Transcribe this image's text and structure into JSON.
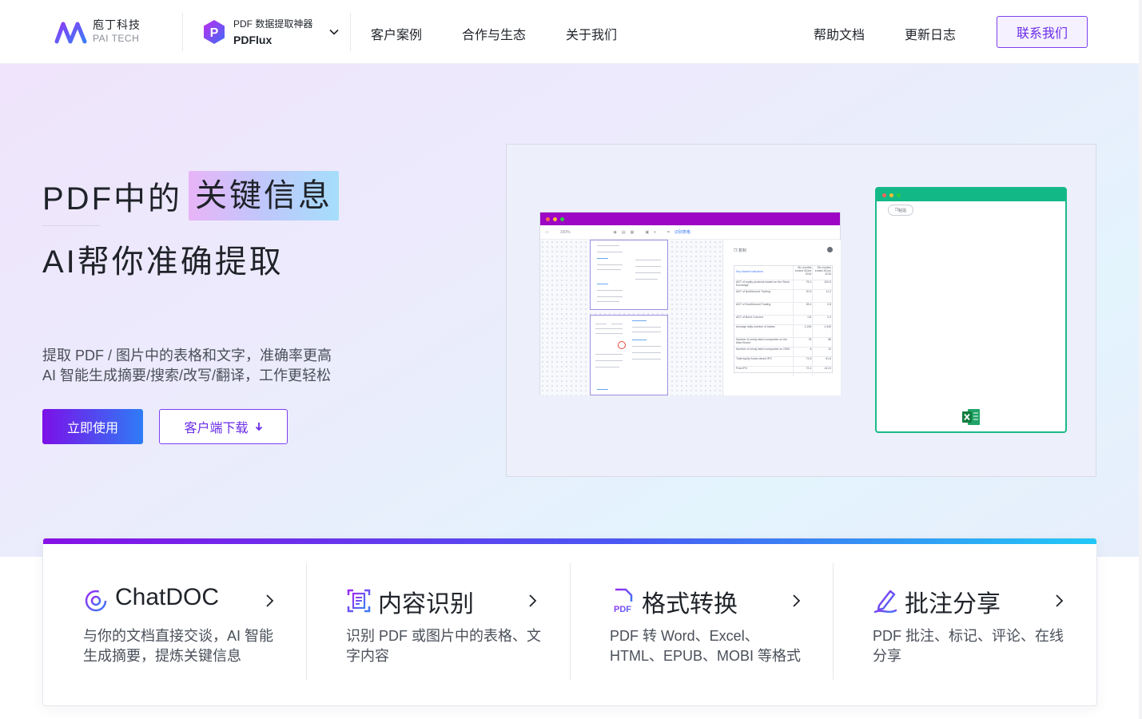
{
  "header": {
    "logo_cn": "庖丁科技",
    "logo_en": "PAI TECH",
    "product_sub": "PDF 数据提取神器",
    "product_name": "PDFlux",
    "nav_left": [
      "客户案例",
      "合作与生态",
      "关于我们"
    ],
    "nav_right": [
      "帮助文档",
      "更新日志"
    ],
    "contact": "联系我们"
  },
  "hero": {
    "title_prefix": "PDF中的",
    "title_highlight": "关键信息",
    "title_line2": "AI帮你准确提取",
    "desc_line1": "提取 PDF / 图片中的表格和文字，准确率更高",
    "desc_line2": "AI 智能生成摘要/搜索/改写/翻译，工作更轻松",
    "btn_primary": "立即使用",
    "btn_download": "客户端下载"
  },
  "demo": {
    "zoom": "100%",
    "toolbar_action": "识别表格",
    "copy_label": "复制",
    "chip_label": "粘贴",
    "table_title": "Key Market Indicators",
    "table_rows": [
      [
        "Six months ended 30Jun 2016",
        "Six months ended 30Jun 2015"
      ],
      [
        "ADT of equity products traded on the Stock Exchange",
        "75.1",
        "100.5"
      ],
      [
        "ADT of Northbound Trading",
        "20.5",
        "11.2"
      ],
      [
        "ADT of Southbound Trading",
        "28.4",
        "0.8"
      ],
      [
        "ADT of Bond Connect",
        "0.8",
        "2.4"
      ],
      [
        "Average daily number of trades",
        "1,245",
        "1,340"
      ],
      [
        "Number of newly listed companies on the Main Board",
        "78",
        "58"
      ],
      [
        "Number of newly listed companies on GEM",
        "8",
        "10"
      ],
      [
        "Total equity funds raised IPO",
        "71.8",
        "51.6"
      ],
      [
        "Post-IPO",
        "72.4",
        "141.5"
      ]
    ],
    "colors": {
      "window1_bar": "#9c06c4",
      "window2_bar": "#12b886"
    }
  },
  "features": [
    {
      "icon": "chat-icon",
      "title": "ChatDOC",
      "desc": "与你的文档直接交谈，AI 智能生成摘要，提炼关键信息"
    },
    {
      "icon": "scan-document-icon",
      "title": "内容识别",
      "desc": "识别 PDF 或图片中的表格、文字内容"
    },
    {
      "icon": "pdf-convert-icon",
      "title": "格式转换",
      "desc": "PDF 转 Word、Excel、HTML、EPUB、MOBI 等格式"
    },
    {
      "icon": "annotate-pen-icon",
      "title": "批注分享",
      "desc": "PDF 批注、标记、评论、在线分享"
    }
  ],
  "colors": {
    "brand_purple": "#7b3ff2",
    "gradient_start": "#7b10e8",
    "gradient_end": "#2e7cf6"
  }
}
